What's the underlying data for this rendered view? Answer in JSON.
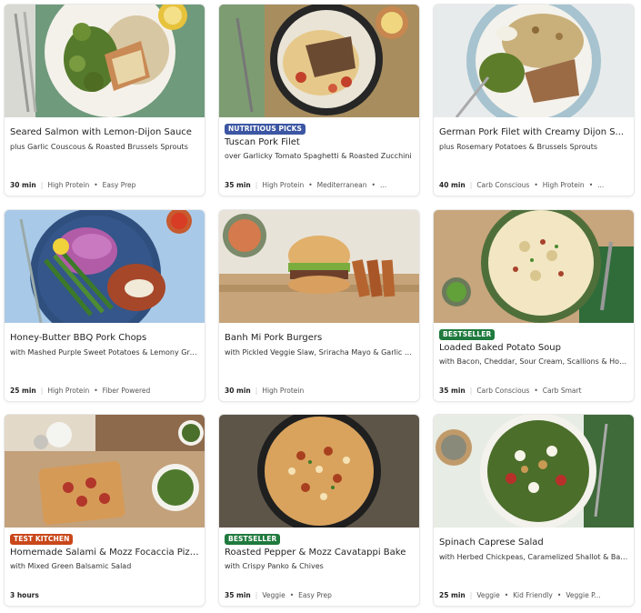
{
  "recipes": [
    {
      "title": "Seared Salmon with Lemon-Dijon Sauce",
      "subtitle": "plus Garlic Couscous & Roasted Brussels Sprouts",
      "tag": "",
      "time": "30 min",
      "tags": [
        "High Protein",
        "Easy Prep"
      ]
    },
    {
      "title": "Tuscan Pork Filet",
      "subtitle": "over Garlicky Tomato Spaghetti & Roasted Zucchini",
      "tag": "Nutritious Picks",
      "time": "35 min",
      "tags": [
        "High Protein",
        "Mediterranean",
        "..."
      ]
    },
    {
      "title": "German Pork Filet with Creamy Dijon S...",
      "subtitle": "plus Rosemary Potatoes & Brussels Sprouts",
      "tag": "",
      "time": "40 min",
      "tags": [
        "Carb Conscious",
        "High Protein",
        "..."
      ]
    },
    {
      "title": "Honey-Butter BBQ Pork Chops",
      "subtitle": "with Mashed Purple Sweet Potatoes & Lemony Gree...",
      "tag": "",
      "time": "25 min",
      "tags": [
        "High Protein",
        "Fiber Powered"
      ]
    },
    {
      "title": "Banh Mi Pork Burgers",
      "subtitle": "with Pickled Veggie Slaw, Sriracha Mayo & Garlic Po...",
      "tag": "",
      "time": "30 min",
      "tags": [
        "High Protein"
      ]
    },
    {
      "title": "Loaded Baked Potato Soup",
      "subtitle": "with Bacon, Cheddar, Sour Cream, Scallions & Hot S...",
      "tag": "Bestseller",
      "time": "35 min",
      "tags": [
        "Carb Conscious",
        "Carb Smart"
      ]
    },
    {
      "title": "Homemade Salami & Mozz Focaccia Pizza",
      "subtitle": "with Mixed Green Balsamic Salad",
      "tag": "Test Kitchen",
      "time": "3 hours",
      "tags": []
    },
    {
      "title": "Roasted Pepper & Mozz Cavatappi Bake",
      "subtitle": "with Crispy Panko & Chives",
      "tag": "Bestseller",
      "time": "35 min",
      "tags": [
        "Veggie",
        "Easy Prep"
      ]
    },
    {
      "title": "Spinach Caprese Salad",
      "subtitle": "with Herbed Chickpeas, Caramelized Shallot & Bals...",
      "tag": "",
      "time": "25 min",
      "tags": [
        "Veggie",
        "Kid Friendly",
        "Veggie P..."
      ]
    }
  ]
}
